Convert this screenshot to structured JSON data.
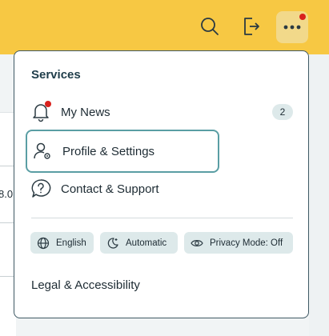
{
  "header": {
    "icons": [
      "search-icon",
      "logout-icon",
      "more-icon"
    ]
  },
  "background": {
    "partial_value": "8.0"
  },
  "menu": {
    "title": "Services",
    "items": [
      {
        "label": "My News",
        "icon": "bell-icon",
        "badge": "2",
        "notification_dot": true
      },
      {
        "label": "Profile & Settings",
        "icon": "profile-settings-icon",
        "focused": true
      },
      {
        "label": "Contact & Support",
        "icon": "question-icon"
      }
    ],
    "chips": [
      {
        "label": "English",
        "icon": "globe-icon"
      },
      {
        "label": "Automatic",
        "icon": "theme-icon"
      },
      {
        "label": "Privacy Mode: Off",
        "icon": "eye-icon"
      }
    ],
    "legal": "Legal & Accessibility"
  },
  "colors": {
    "topbar": "#f7c843",
    "accent_focus": "#5a9ea4",
    "notification": "#d9211d",
    "chip_bg": "#dde9ea"
  }
}
